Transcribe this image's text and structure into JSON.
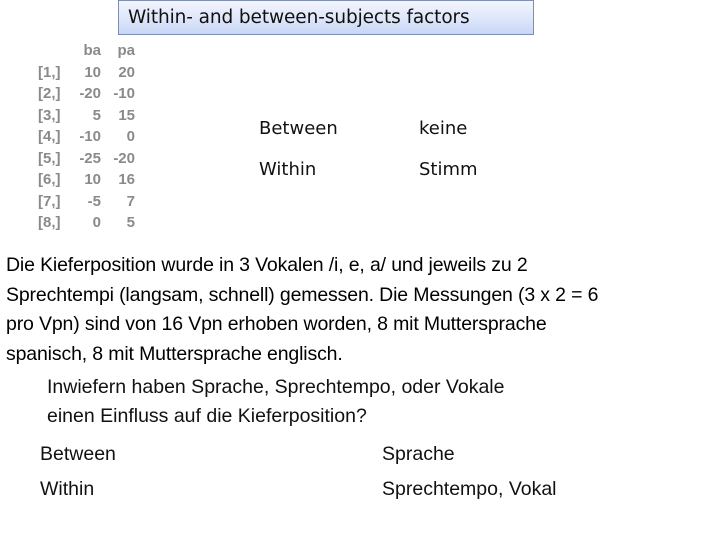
{
  "title": "Within- and between-subjects factors",
  "matrix": {
    "columns": [
      "ba",
      "pa"
    ],
    "rows": [
      {
        "label": "[1,]",
        "ba": "10",
        "pa": "20"
      },
      {
        "label": "[2,]",
        "ba": "-20",
        "pa": "-10"
      },
      {
        "label": "[3,]",
        "ba": "5",
        "pa": "15"
      },
      {
        "label": "[4,]",
        "ba": "-10",
        "pa": "0"
      },
      {
        "label": "[5,]",
        "ba": "-25",
        "pa": "-20"
      },
      {
        "label": "[6,]",
        "ba": "10",
        "pa": "16"
      },
      {
        "label": "[7,]",
        "ba": "-5",
        "pa": "7"
      },
      {
        "label": "[8,]",
        "ba": "0",
        "pa": "5"
      }
    ]
  },
  "factors_example": [
    {
      "type": "Between",
      "value": "keine"
    },
    {
      "type": "Within",
      "value": "Stimm"
    }
  ],
  "description": "Die Kieferposition wurde in 3 Vokalen /i, e, a/ und jeweils zu 2 Sprechtempi (langsam, schnell) gemessen. Die Messungen (3 x 2 = 6 pro Vpn) sind von 16 Vpn erhoben worden, 8 mit Muttersprache spanisch, 8 mit Muttersprache englisch.",
  "description_lines": [
    "Die Kieferposition wurde in 3 Vokalen /i, e, a/ und jeweils zu 2",
    "Sprechtempi (langsam, schnell) gemessen. Die Messungen (3 x 2 = 6",
    "pro Vpn) sind von 16 Vpn erhoben worden, 8 mit Muttersprache",
    "spanisch, 8 mit Muttersprache englisch."
  ],
  "question_lines": [
    "Inwiefern haben Sprache, Sprechtempo, oder Vokale",
    "einen Einfluss auf die Kieferposition?"
  ],
  "factors_answer": [
    {
      "type": "Between",
      "value": "Sprache"
    },
    {
      "type": "Within",
      "value": "Sprechtempo, Vokal"
    }
  ]
}
